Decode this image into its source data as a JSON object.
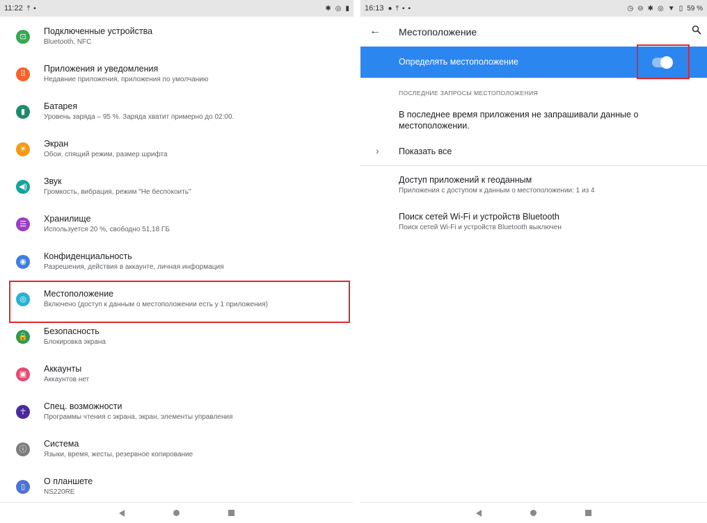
{
  "left": {
    "status_bar": {
      "time": "11:22",
      "icons_left": [
        "upload-icon",
        "sd-card-icon"
      ],
      "icons_right": [
        "bluetooth-icon",
        "location-icon",
        "battery-icon"
      ]
    },
    "settings": [
      {
        "title": "Подключенные устройства",
        "subtitle": "Bluetooth, NFC",
        "icon": "devices-icon",
        "color": "#35a853",
        "glyph": "⊡"
      },
      {
        "title": "Приложения и уведомления",
        "subtitle": "Недавние приложения, приложения по умолчанию",
        "icon": "apps-icon",
        "color": "#f4632b",
        "glyph": "⠿"
      },
      {
        "title": "Батарея",
        "subtitle": "Уровень заряда – 95 %. Заряда хватит примерно до 02:00.",
        "icon": "battery-icon",
        "color": "#1f8a6b",
        "glyph": "▮"
      },
      {
        "title": "Экран",
        "subtitle": "Обои, спящий режим, размер шрифта",
        "icon": "display-icon",
        "color": "#f59a14",
        "glyph": "☀"
      },
      {
        "title": "Звук",
        "subtitle": "Громкость, вибрация, режим \"Не беспокоить\"",
        "icon": "sound-icon",
        "color": "#12a39c",
        "glyph": "◀)"
      },
      {
        "title": "Хранилище",
        "subtitle": "Используется 20 %, свободно 51,18 ГБ",
        "icon": "storage-icon",
        "color": "#9b3fc4",
        "glyph": "☰"
      },
      {
        "title": "Конфиденциальность",
        "subtitle": "Разрешения, действия в аккаунте, личная информация",
        "icon": "privacy-icon",
        "color": "#3f7ee0",
        "glyph": "◉"
      },
      {
        "title": "Местоположение",
        "subtitle": "Включено (доступ к данным о местоположении есть у 1 приложения)",
        "icon": "location-icon",
        "color": "#25b4d4",
        "glyph": "◎"
      },
      {
        "title": "Безопасность",
        "subtitle": "Блокировка экрана",
        "icon": "security-lock-icon",
        "color": "#2d9a4f",
        "glyph": "🔒"
      },
      {
        "title": "Аккаунты",
        "subtitle": "Аккаунтов нет",
        "icon": "accounts-icon",
        "color": "#e64a72",
        "glyph": "▣"
      },
      {
        "title": "Спец. возможности",
        "subtitle": "Программы чтения с экрана, экран, элементы управления",
        "icon": "accessibility-icon",
        "color": "#4a2a9e",
        "glyph": "☥"
      },
      {
        "title": "Система",
        "subtitle": "Языки, время, жесты, резервное копирование",
        "icon": "system-info-icon",
        "color": "#7d7d7d",
        "glyph": "ⓘ"
      },
      {
        "title": "О планшете",
        "subtitle": "NS220RE",
        "icon": "tablet-icon",
        "color": "#4c74d6",
        "glyph": "▯"
      }
    ]
  },
  "right": {
    "status_bar": {
      "time": "16:13",
      "battery": "59 %",
      "icons_left": [
        "cloud-icon",
        "upload-icon",
        "file-icon",
        "sd-card-icon"
      ],
      "icons_right": [
        "alarm-icon",
        "vibrate-icon",
        "bluetooth-icon",
        "location-icon",
        "wifi-icon",
        "battery-icon"
      ]
    },
    "app_bar": {
      "title": "Местоположение"
    },
    "toggle": {
      "label": "Определять местоположение",
      "state": "on"
    },
    "section_header": "ПОСЛЕДНИЕ ЗАПРОСЫ МЕСТОПОЛОЖЕНИЯ",
    "no_requests": "В последнее время приложения не запрашивали данные о местоположении.",
    "show_all": "Показать все",
    "items": [
      {
        "title": "Доступ приложений к геоданным",
        "subtitle": "Приложения с доступом к данным о местоположении: 1 из 4"
      },
      {
        "title": "Поиск сетей Wi‑Fi и устройств Bluetooth",
        "subtitle": "Поиск сетей Wi‑Fi и устройств Bluetooth выключен"
      }
    ]
  },
  "colors": {
    "accent": "#2b86f0",
    "highlight": "#e0262c"
  }
}
